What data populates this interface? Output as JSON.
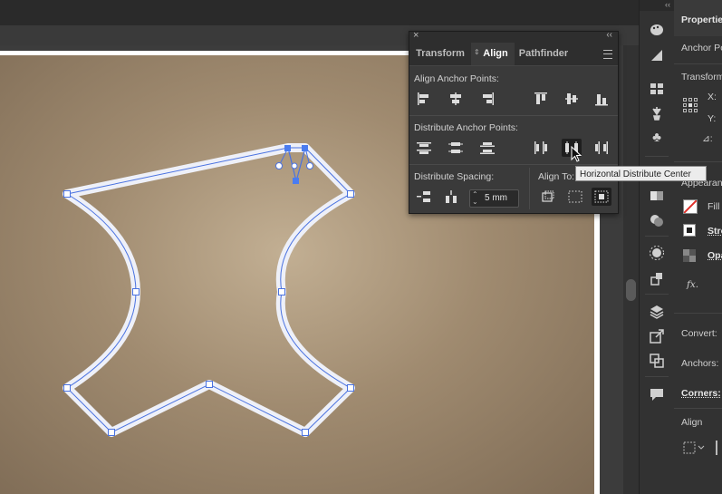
{
  "colors": {
    "accent": "#4a7cf0",
    "path_stroke": "#4a72e0",
    "panel_bg": "#3a3a3a"
  },
  "align_panel": {
    "tabs": [
      "Transform",
      "Align",
      "Pathfinder"
    ],
    "active_tab": "Align",
    "sections": {
      "align_anchor_points": "Align Anchor Points:",
      "distribute_anchor_points": "Distribute Anchor Points:",
      "distribute_spacing": "Distribute Spacing:",
      "align_to": "Align To:"
    },
    "spacing_value": "5 mm",
    "tooltip": "Horizontal Distribute Center"
  },
  "properties": {
    "title": "Properties",
    "anchor_point": "Anchor Po",
    "transform": "Transform",
    "x_label": "X:",
    "y_label": "Y:",
    "angle_label": "⊿:",
    "appearance": "Appearan",
    "fill": "Fill",
    "stroke": "Stro",
    "opacity": "Opa",
    "fx": "fx.",
    "convert": "Convert:",
    "anchors": "Anchors:",
    "corners": "Corners:",
    "align": "Align"
  },
  "toolbar_icons": [
    "paint-palette-icon",
    "gradient-icon",
    "swatch-grid-icon",
    "brush-icon",
    "club-symbol-icon",
    "stroke-icon",
    "gradient-panel-icon",
    "transparency-icon",
    "appearance-icon",
    "graphic-styles-icon",
    "layers-icon",
    "export-icon",
    "artboards-icon",
    "comments-icon"
  ]
}
